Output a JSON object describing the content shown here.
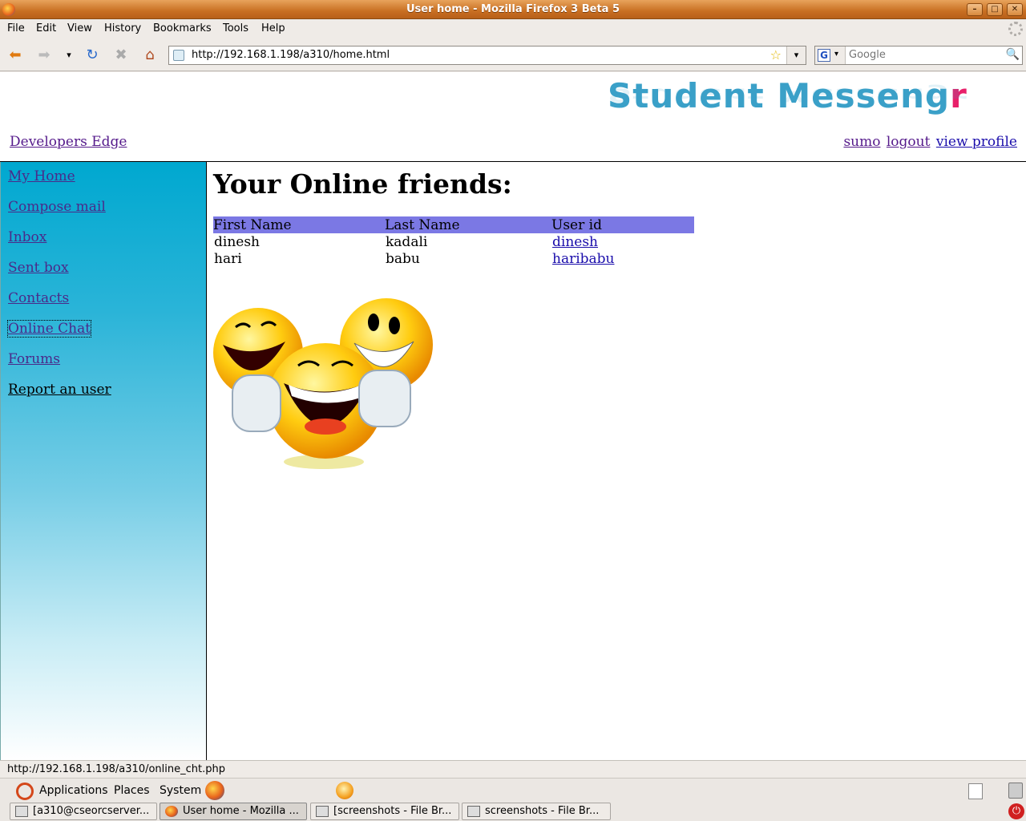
{
  "window": {
    "title": "User home - Mozilla Firefox 3 Beta 5",
    "minimize": "–",
    "maximize": "□",
    "close": "✕"
  },
  "menu": [
    "File",
    "Edit",
    "View",
    "History",
    "Bookmarks",
    "Tools",
    "Help"
  ],
  "nav": {
    "back_icon": "left-arrow-icon",
    "forward_icon": "right-arrow-icon",
    "url": "http://192.168.1.198/a310/home.html",
    "search_placeholder": "Google"
  },
  "page": {
    "brand": "Student Messeng",
    "brand_accent": "r",
    "developers_link": "Developers Edge",
    "user_links": {
      "user": "sumo",
      "logout": "logout",
      "profile": "view profile"
    },
    "sidebar": [
      "My Home",
      "Compose mail",
      "Inbox",
      "Sent box",
      "Contacts",
      "Online Chat",
      "Forums",
      "Report an user"
    ],
    "heading": "Your Online friends:",
    "table": {
      "headers": [
        "First Name",
        "Last Name",
        "User id"
      ],
      "rows": [
        [
          "dinesh",
          "kadali",
          "dinesh"
        ],
        [
          "hari",
          "babu",
          "haribabu"
        ]
      ]
    }
  },
  "status": "http://192.168.1.198/a310/online_cht.php",
  "panel": {
    "applications": "Applications",
    "places": "Places",
    "system": "System"
  },
  "taskbar": [
    "[a310@cseorcserver...",
    "User home - Mozilla ...",
    "[screenshots - File Br...",
    "screenshots - File Br..."
  ],
  "colors": {
    "table_header": "#7b78e4",
    "sidebar_top": "#00a8d0",
    "brand": "#3aa0c8",
    "brand_accent": "#e8206a"
  }
}
